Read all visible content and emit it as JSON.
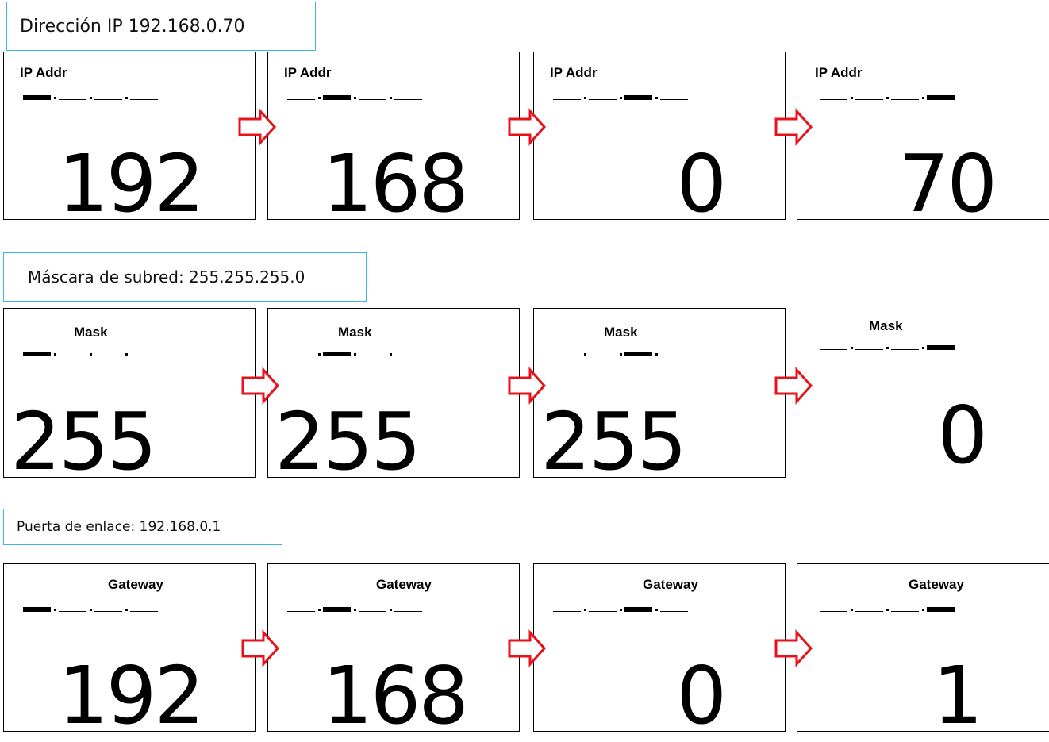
{
  "sections": [
    {
      "label": "Dirección IP 192.168.0.70",
      "screen_title": "IP Addr",
      "values": [
        "192",
        "168",
        "0",
        "70"
      ]
    },
    {
      "label": "Máscara de subred: 255.255.255.0",
      "screen_title": "Mask",
      "values": [
        "255",
        "255",
        "255",
        "0"
      ]
    },
    {
      "label": "Puerta de enlace: 192.168.0.1",
      "screen_title": "Gateway",
      "values": [
        "192",
        "168",
        "0",
        "1"
      ]
    }
  ],
  "colors": {
    "label_border": "#41b4e6",
    "arrow_stroke": "#e8121b"
  },
  "icons": {
    "step_arrow": "right-arrow-icon"
  }
}
